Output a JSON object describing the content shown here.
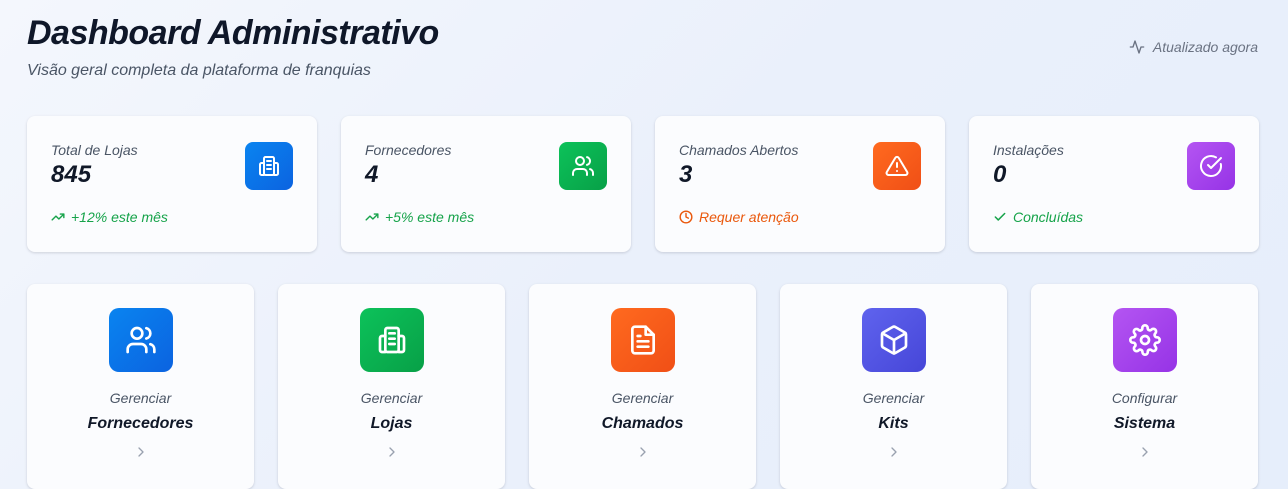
{
  "header": {
    "title": "Dashboard Administrativo",
    "subtitle": "Visão geral completa da plataforma de franquias",
    "updated": "Atualizado agora"
  },
  "stats": [
    {
      "label": "Total de Lojas",
      "value": "845",
      "foot": "+12% este mês",
      "icon": "building-icon",
      "color": "#0b6fe8"
    },
    {
      "label": "Fornecedores",
      "value": "4",
      "foot": "+5% este mês",
      "icon": "users-icon",
      "color": "#0ab052"
    },
    {
      "label": "Chamados Abertos",
      "value": "3",
      "foot": "Requer atenção",
      "icon": "alert-triangle-icon",
      "color": "#f65b1b"
    },
    {
      "label": "Instalações",
      "value": "0",
      "foot": "Concluídas",
      "icon": "check-circle-icon",
      "color": "#a644ec"
    }
  ],
  "actions": [
    {
      "verb": "Gerenciar",
      "name": "Fornecedores",
      "icon": "users-icon",
      "color": "#0b6fe8"
    },
    {
      "verb": "Gerenciar",
      "name": "Lojas",
      "icon": "building-icon",
      "color": "#0ab052"
    },
    {
      "verb": "Gerenciar",
      "name": "Chamados",
      "icon": "file-text-icon",
      "color": "#f65b1b"
    },
    {
      "verb": "Gerenciar",
      "name": "Kits",
      "icon": "box-icon",
      "color": "#5254e2"
    },
    {
      "verb": "Configurar",
      "name": "Sistema",
      "icon": "settings-icon",
      "color": "#a644ec"
    }
  ]
}
